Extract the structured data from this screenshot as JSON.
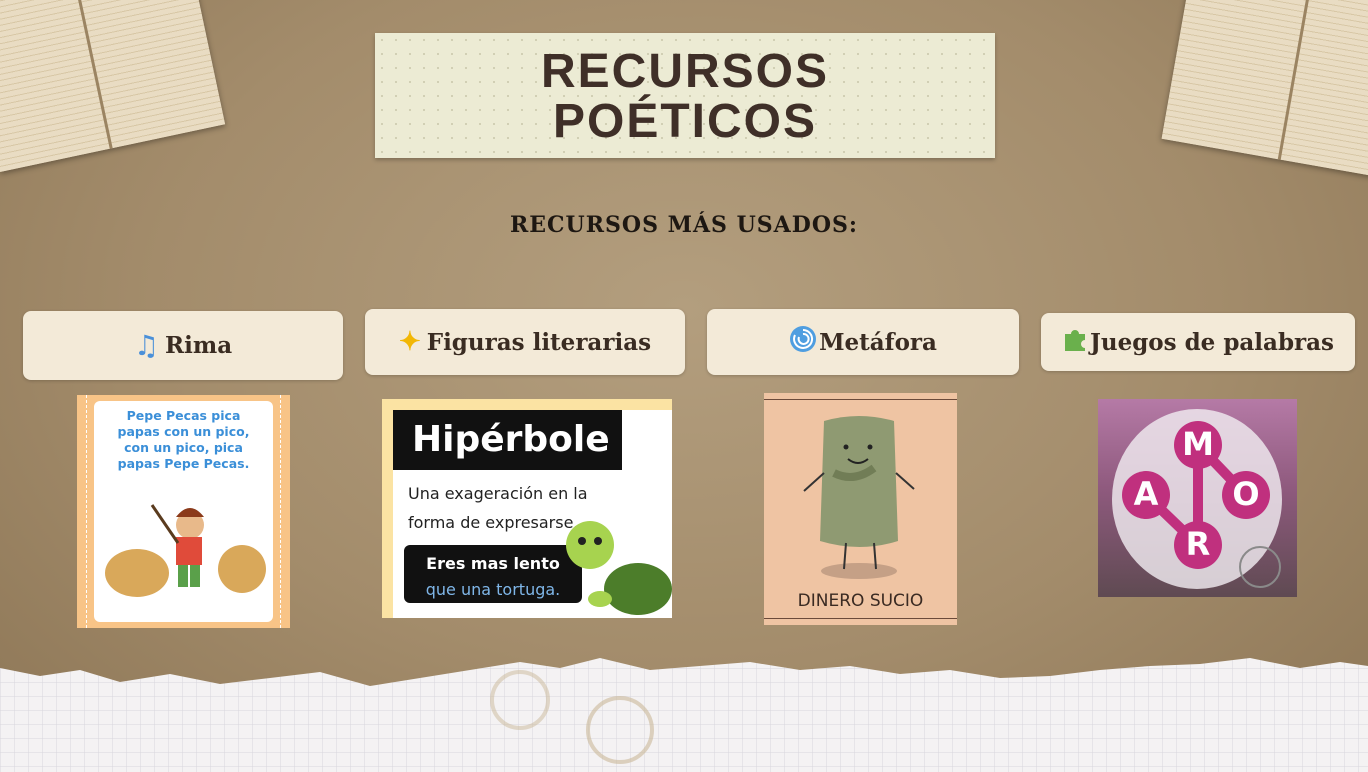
{
  "title": {
    "line1": "RECURSOS",
    "line2": "POÉTICOS"
  },
  "subtitle": "RECURSOS MÁS USADOS:",
  "cards": [
    {
      "label": "Rima",
      "icon": "music-note-icon",
      "image_text": [
        "Pepe Pecas pica",
        "papas con un pico,",
        "con un pico, pica",
        "papas Pepe Pecas."
      ]
    },
    {
      "label": "Figuras literarias",
      "icon": "sparkles-icon",
      "image_heading": "Hipérbole",
      "image_lines": [
        "Una exageración en la",
        "forma de expresarse."
      ],
      "bubble_lines": [
        "Eres mas lento",
        "que una tortuga."
      ]
    },
    {
      "label": "Metáfora",
      "icon": "cyclone-icon",
      "image_caption": "DINERO SUCIO"
    },
    {
      "label": "Juegos de palabras",
      "icon": "puzzle-piece-icon",
      "letters": [
        "M",
        "A",
        "O",
        "R"
      ]
    }
  ],
  "colors": {
    "background": "#a38c6b",
    "title_paper": "#ecebd4",
    "label_bg": "#f3ead8",
    "letter_bubble": "#c0307e"
  }
}
